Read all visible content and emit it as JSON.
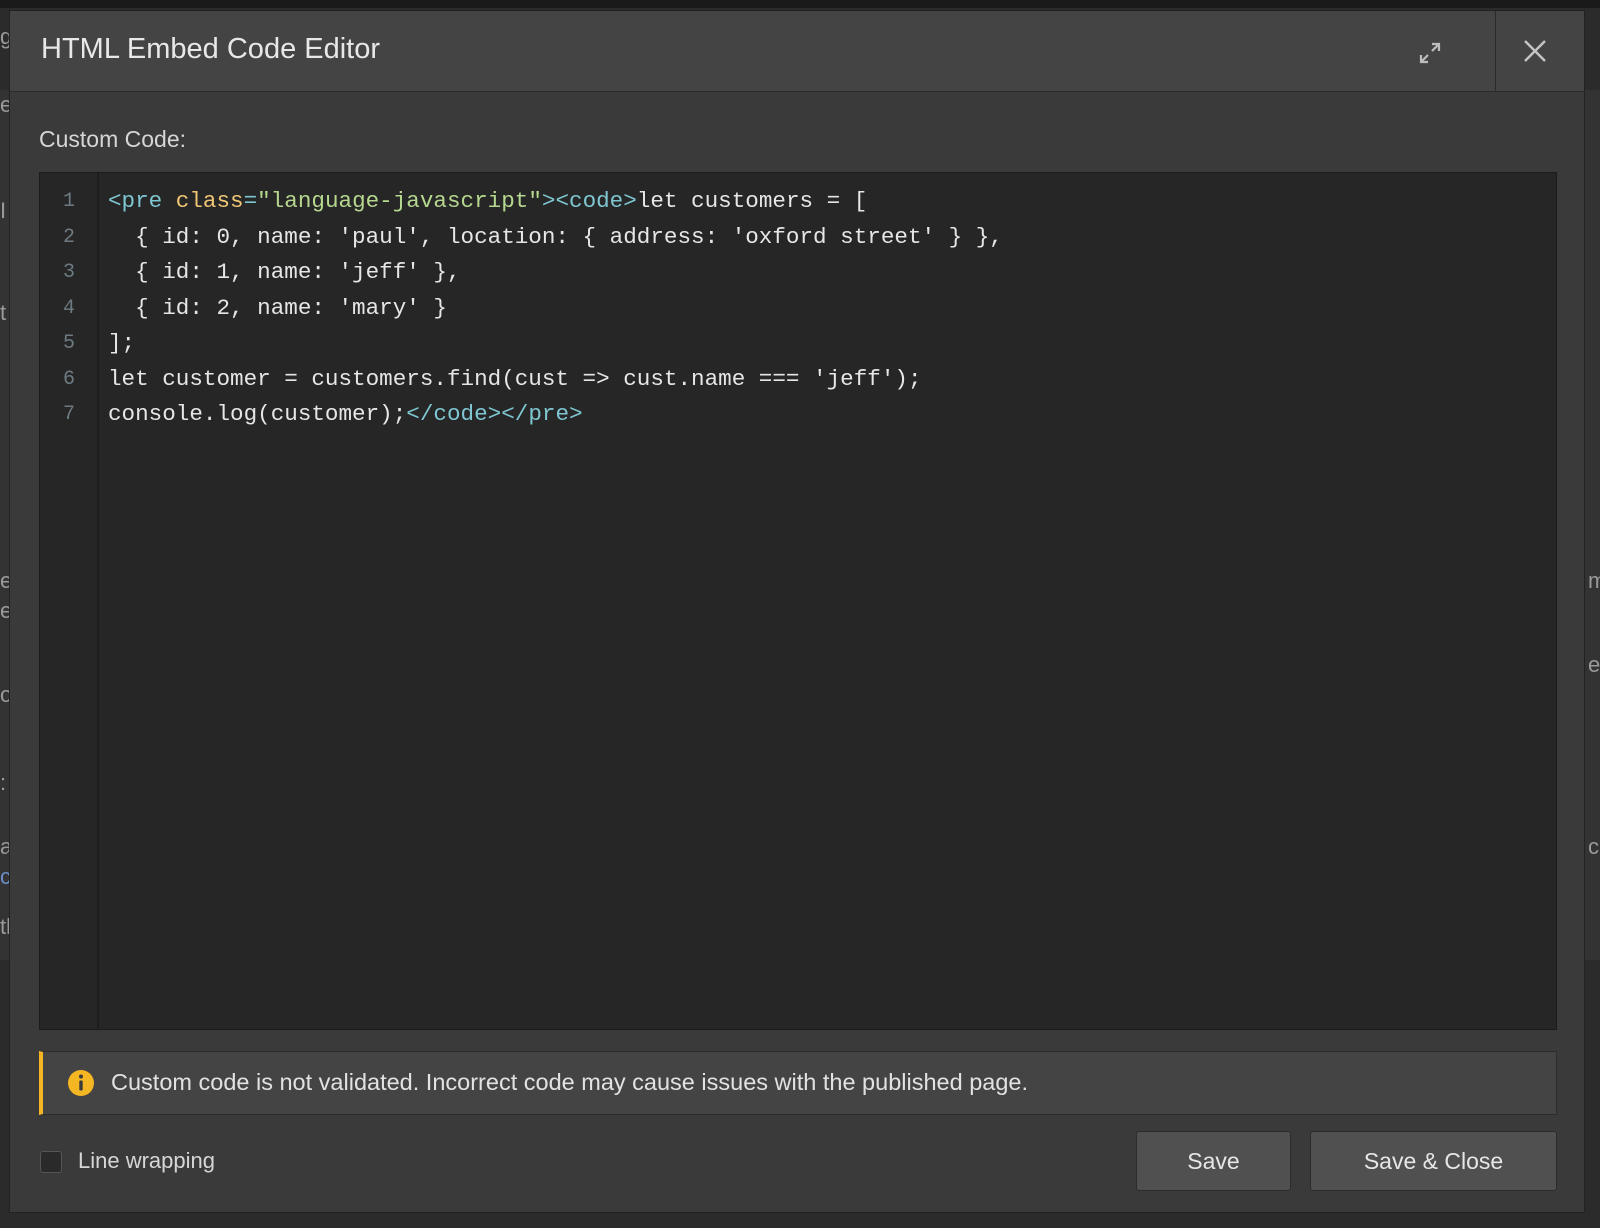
{
  "background": {
    "left_glyphs": [
      "g",
      "e",
      "I",
      "t",
      "e",
      "e",
      "o",
      ":",
      "a",
      "c",
      "tl"
    ],
    "right_glyphs": [
      "m",
      "e",
      "c"
    ]
  },
  "modal": {
    "title": "HTML Embed Code Editor",
    "expand_icon": "expand-icon",
    "close_icon": "close-icon"
  },
  "editor": {
    "label": "Custom Code:",
    "line_numbers": [
      "1",
      "2",
      "3",
      "4",
      "5",
      "6",
      "7"
    ],
    "lines": [
      [
        {
          "t": "tag",
          "v": "<pre "
        },
        {
          "t": "attr",
          "v": "class"
        },
        {
          "t": "tag",
          "v": "="
        },
        {
          "t": "str",
          "v": "\"language-javascript\""
        },
        {
          "t": "tag",
          "v": "><code>"
        },
        {
          "t": "text",
          "v": "let customers = ["
        }
      ],
      [
        {
          "t": "text",
          "v": "  { id: 0, name: 'paul', location: { address: 'oxford street' } },"
        }
      ],
      [
        {
          "t": "text",
          "v": "  { id: 1, name: 'jeff' },"
        }
      ],
      [
        {
          "t": "text",
          "v": "  { id: 2, name: 'mary' }"
        }
      ],
      [
        {
          "t": "text",
          "v": "];"
        }
      ],
      [
        {
          "t": "text",
          "v": "let customer = customers.find(cust => cust.name === 'jeff');"
        }
      ],
      [
        {
          "t": "text",
          "v": "console.log(customer);"
        },
        {
          "t": "tag",
          "v": "</code></pre>"
        }
      ]
    ]
  },
  "notice": {
    "icon": "info-icon",
    "text": "Custom code is not validated. Incorrect code may cause issues with the published page.",
    "accent_color": "#f5b623"
  },
  "footer": {
    "line_wrapping_label": "Line wrapping",
    "line_wrapping_checked": false,
    "save_label": "Save",
    "save_close_label": "Save & Close"
  }
}
